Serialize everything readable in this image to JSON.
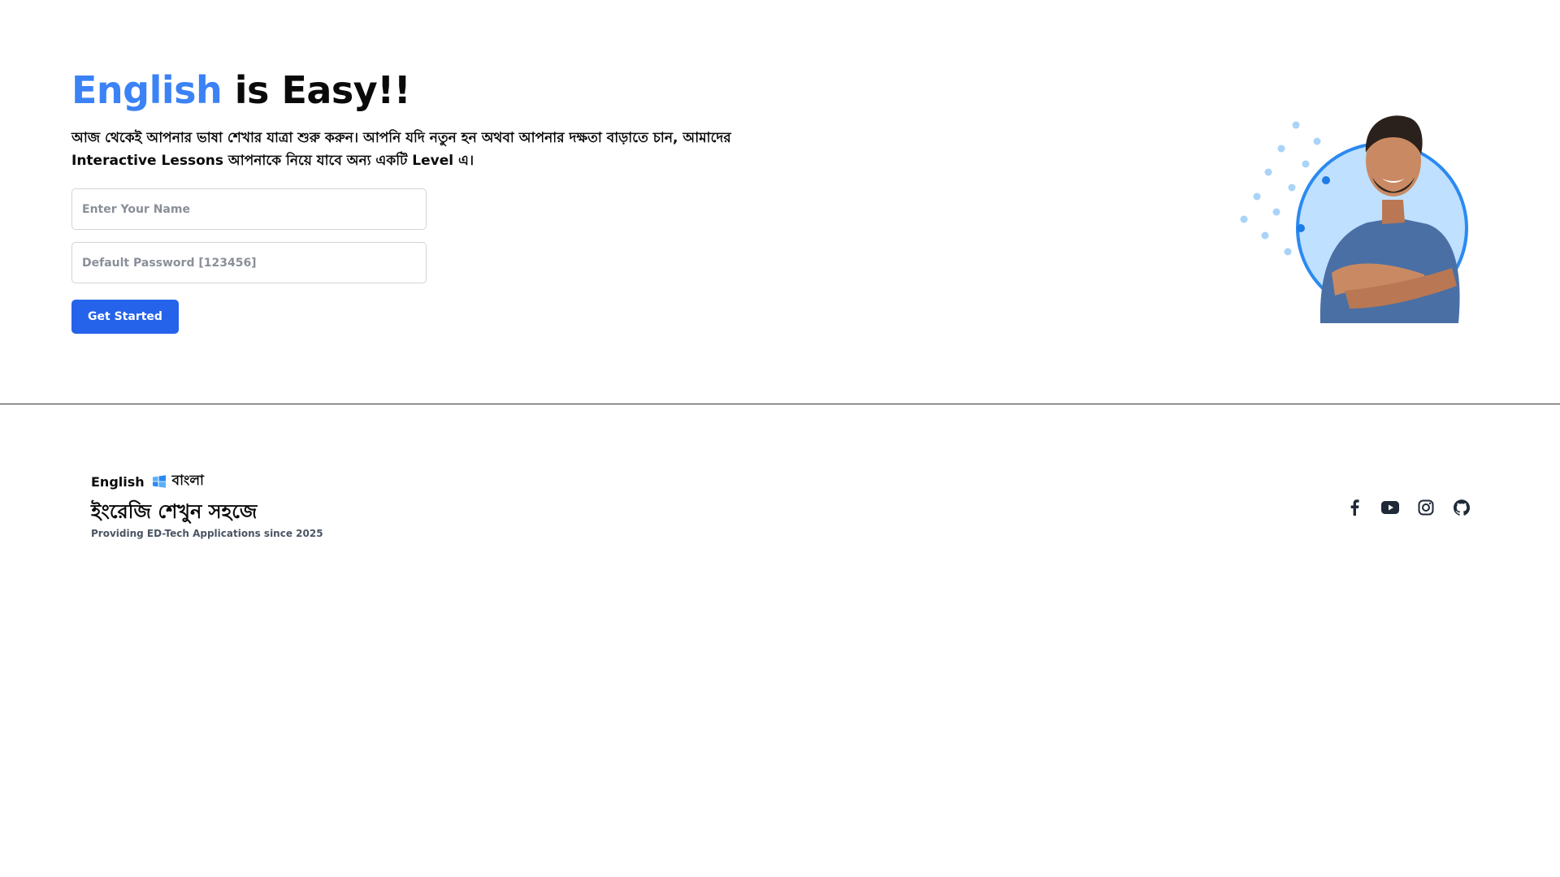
{
  "hero": {
    "title_accent": "English",
    "title_rest": " is Easy!!",
    "description": "আজ থেকেই আপনার ভাষা শেখার যাত্রা শুরু করুন। আপনি যদি নতুন হন অথবা আপনার দক্ষতা বাড়াতে চান, আমাদের Interactive Lessons আপনাকে নিয়ে যাবে অন্য একটি Level এ।",
    "accent_color": "#3b82f6"
  },
  "form": {
    "name_placeholder": "Enter Your Name",
    "password_placeholder": "Default Password [123456]",
    "submit_label": "Get Started",
    "button_color": "#2563eb"
  },
  "illustration": {
    "icon": "smiling-man-avatar",
    "ring_color": "#3b8fe8",
    "circle_fill": "#bfe0ff"
  },
  "footer": {
    "brand_en": "English",
    "brand_bn": "বাংলা",
    "brand_icon": "windows-logo-icon",
    "tagline": "ইংরেজি শেখুন সহজে",
    "since": "Providing ED-Tech Applications since 2025",
    "socials": [
      {
        "name": "facebook",
        "icon": "facebook-icon"
      },
      {
        "name": "youtube",
        "icon": "youtube-icon"
      },
      {
        "name": "instagram",
        "icon": "instagram-icon"
      },
      {
        "name": "github",
        "icon": "github-icon"
      }
    ]
  }
}
